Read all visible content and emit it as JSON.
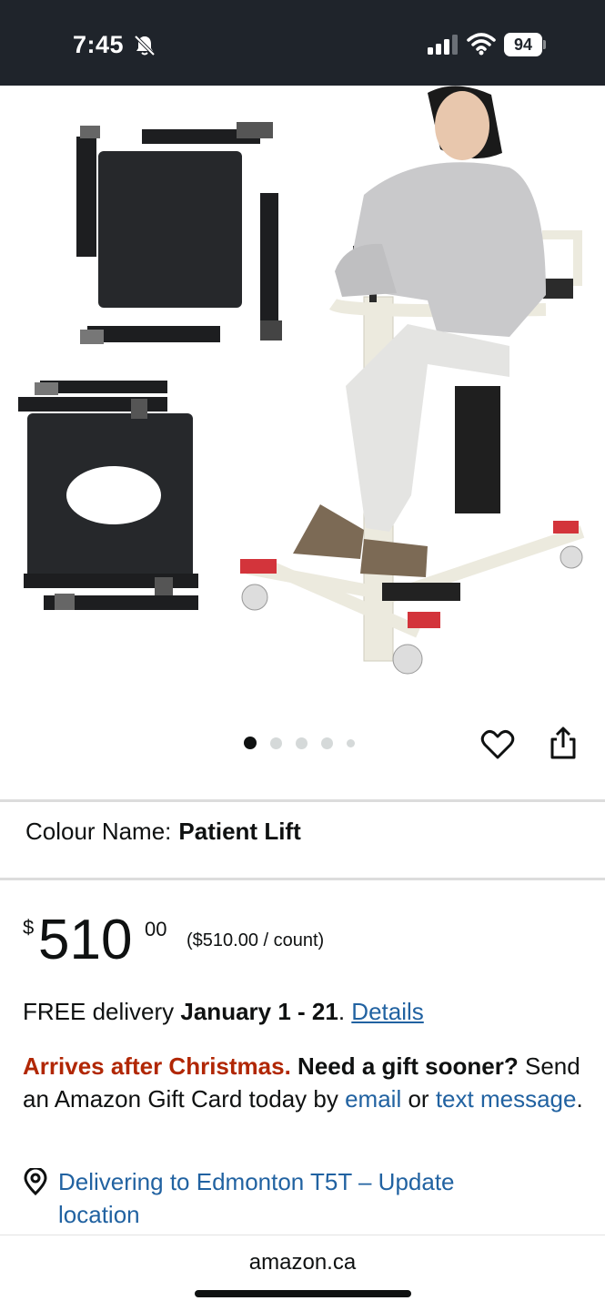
{
  "status_bar": {
    "time": "7:45",
    "battery": "94",
    "icons": [
      "bell-slash-icon",
      "signal-icon",
      "wifi-icon",
      "battery-icon"
    ]
  },
  "product": {
    "image_count": 5,
    "active_image": 1,
    "actions": [
      "heart-icon",
      "share-icon"
    ]
  },
  "colour": {
    "label": "Colour Name:",
    "value": "Patient Lift"
  },
  "price": {
    "currency": "$",
    "whole": "510",
    "fraction": "00",
    "unit_price": "($510.00 / count)"
  },
  "delivery": {
    "prefix": "FREE delivery",
    "dates": "January 1 - 21",
    "period": ".",
    "details_link": "Details"
  },
  "promo": {
    "warning": "Arrives after Christmas.",
    "question": "Need a gift sooner?",
    "text": "Send an Amazon Gift Card today by",
    "email_link": "email",
    "or": "or",
    "text_link": "text message",
    "end": "."
  },
  "location": {
    "text": "Delivering to Edmonton T5T – Update location"
  },
  "browser": {
    "domain": "amazon.ca"
  },
  "colors": {
    "status_bar_bg": "#1f242b",
    "link": "#2162a1",
    "warning_red": "#b12704"
  }
}
